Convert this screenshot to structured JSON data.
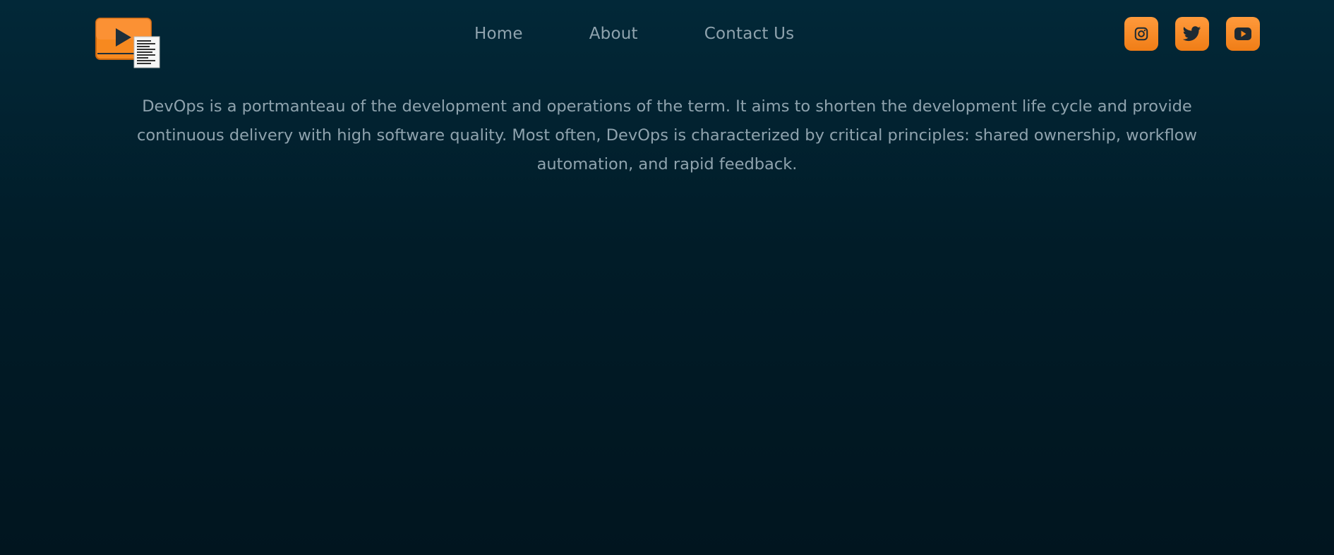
{
  "header": {
    "logo_icon": "video-document-icon",
    "nav": [
      {
        "label": "Home"
      },
      {
        "label": "About"
      },
      {
        "label": "Contact Us"
      }
    ],
    "social": [
      {
        "icon": "instagram-icon"
      },
      {
        "icon": "twitter-icon"
      },
      {
        "icon": "youtube-icon"
      }
    ]
  },
  "main": {
    "description": "DevOps is a portmanteau of the development and operations of the term. It aims to shorten the development life cycle and provide continuous delivery with high software quality. Most often, DevOps is characterized by critical principles: shared ownership, workflow automation, and rapid feedback."
  },
  "colors": {
    "background_top": "#022838",
    "background_bottom": "#01151f",
    "accent": "#f7891f",
    "text": "#8fa3ae"
  }
}
